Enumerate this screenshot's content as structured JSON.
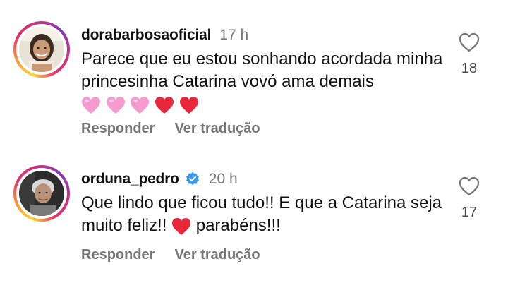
{
  "comments": [
    {
      "username": "dorabarbosaoficial",
      "time": "17 h",
      "text": "Parece que eu estou sonhando acordada minha princesinha Catarina vovó ama demais",
      "emojis": [
        "pink-heart",
        "pink-heart",
        "pink-heart",
        "red-heart",
        "red-heart"
      ],
      "likes": "18",
      "reply_label": "Responder",
      "translate_label": "Ver tradução",
      "verified": false
    },
    {
      "username": "orduna_pedro",
      "time": "20 h",
      "text_before": "Que lindo que ficou tudo!! E que a Catarina seja muito feliz!!",
      "text_after": "parabéns!!!",
      "emojis": [
        "red-heart"
      ],
      "likes": "17",
      "reply_label": "Responder",
      "translate_label": "Ver tradução",
      "verified": true
    }
  ],
  "colors": {
    "text": "#111111",
    "muted": "#757575",
    "verified_blue": "#3897f0",
    "heart_red": "#e8283a",
    "heart_pink": "#f59bd0"
  }
}
